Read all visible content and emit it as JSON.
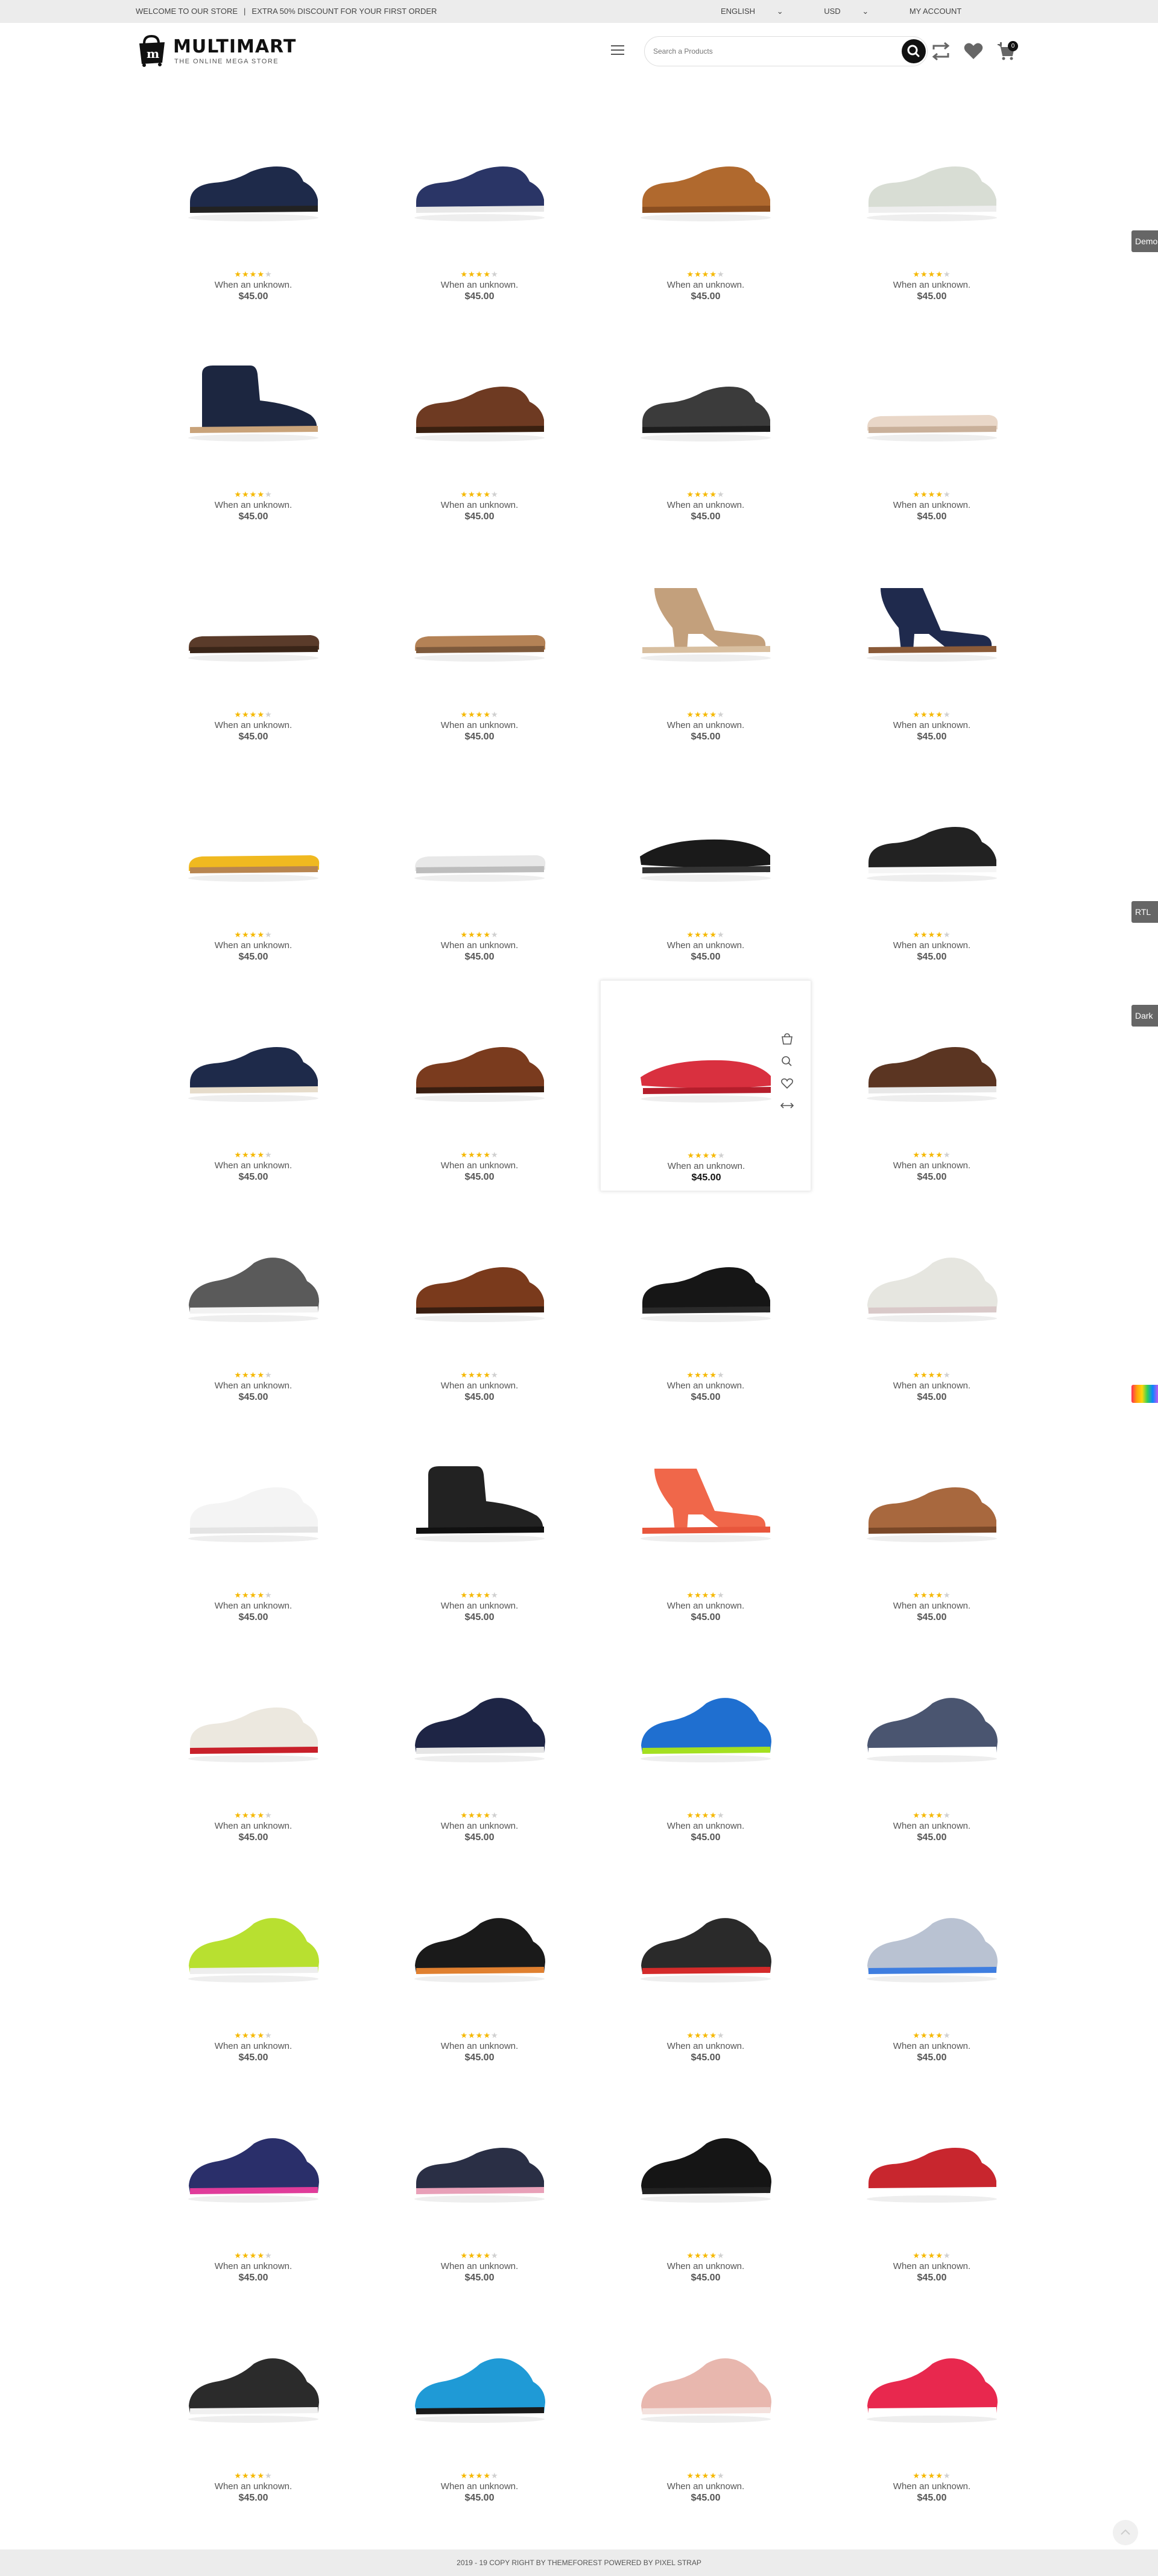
{
  "topbar": {
    "welcome": "WELCOME TO OUR STORE",
    "promo": "EXTRA 50% DISCOUNT FOR YOUR FIRST ORDER",
    "language": "ENGLISH",
    "currency": "USD",
    "account": "MY ACCOUNT"
  },
  "header": {
    "logo_title": "MULTIMART",
    "logo_tagline": "THE ONLINE MEGA STORE",
    "search_placeholder": "Search a Products",
    "cart_count": "0"
  },
  "rating_stars": 4,
  "products": [
    {
      "name": "When an unknown.",
      "price": "$45.00",
      "icon": "navy-suede-oxford"
    },
    {
      "name": "When an unknown.",
      "price": "$45.00",
      "icon": "navy-slip-on-sneaker"
    },
    {
      "name": "When an unknown.",
      "price": "$45.00",
      "icon": "tan-woven-loafer"
    },
    {
      "name": "When an unknown.",
      "price": "$45.00",
      "icon": "grey-canvas-sneaker"
    },
    {
      "name": "When an unknown.",
      "price": "$45.00",
      "icon": "navy-chukka-boot"
    },
    {
      "name": "When an unknown.",
      "price": "$45.00",
      "icon": "brown-brogue"
    },
    {
      "name": "When an unknown.",
      "price": "$45.00",
      "icon": "dark-grey-brogue"
    },
    {
      "name": "When an unknown.",
      "price": "$45.00",
      "icon": "lace-flat"
    },
    {
      "name": "When an unknown.",
      "price": "$45.00",
      "icon": "brown-flip-flop"
    },
    {
      "name": "When an unknown.",
      "price": "$45.00",
      "icon": "tan-flip-flop"
    },
    {
      "name": "When an unknown.",
      "price": "$45.00",
      "icon": "strappy-wedge-sandal"
    },
    {
      "name": "When an unknown.",
      "price": "$45.00",
      "icon": "navy-block-heel-bootie"
    },
    {
      "name": "When an unknown.",
      "price": "$45.00",
      "icon": "yellow-thong-sandal"
    },
    {
      "name": "When an unknown.",
      "price": "$45.00",
      "icon": "white-platform-sandal"
    },
    {
      "name": "When an unknown.",
      "price": "$45.00",
      "icon": "black-strap-slide"
    },
    {
      "name": "When an unknown.",
      "price": "$45.00",
      "icon": "checkered-skate-shoe"
    },
    {
      "name": "When an unknown.",
      "price": "$45.00",
      "icon": "navy-knit-oxford"
    },
    {
      "name": "When an unknown.",
      "price": "$45.00",
      "icon": "brown-cap-toe-oxford"
    },
    {
      "name": "When an unknown.",
      "price": "$45.00",
      "icon": "red-pool-slide"
    },
    {
      "name": "When an unknown.",
      "price": "$45.00",
      "icon": "brown-casual-oxford"
    },
    {
      "name": "When an unknown.",
      "price": "$45.00",
      "icon": "grey-running-shoe"
    },
    {
      "name": "When an unknown.",
      "price": "$45.00",
      "icon": "brown-derby"
    },
    {
      "name": "When an unknown.",
      "price": "$45.00",
      "icon": "black-loafer"
    },
    {
      "name": "When an unknown.",
      "price": "$45.00",
      "icon": "pastel-sneaker"
    },
    {
      "name": "When an unknown.",
      "price": "$45.00",
      "icon": "white-leather-sneaker"
    },
    {
      "name": "When an unknown.",
      "price": "$45.00",
      "icon": "black-combat-boot"
    },
    {
      "name": "When an unknown.",
      "price": "$45.00",
      "icon": "coral-block-heel-sandal"
    },
    {
      "name": "When an unknown.",
      "price": "$45.00",
      "icon": "tan-suede-loafer"
    },
    {
      "name": "When an unknown.",
      "price": "$45.00",
      "icon": "white-striped-sneaker"
    },
    {
      "name": "When an unknown.",
      "price": "$45.00",
      "icon": "navy-red-trainer"
    },
    {
      "name": "When an unknown.",
      "price": "$45.00",
      "icon": "blue-lime-running-shoe"
    },
    {
      "name": "When an unknown.",
      "price": "$45.00",
      "icon": "grey-swoosh-sneaker"
    },
    {
      "name": "When an unknown.",
      "price": "$45.00",
      "icon": "lime-running-shoe"
    },
    {
      "name": "When an unknown.",
      "price": "$45.00",
      "icon": "black-orange-trail-shoe"
    },
    {
      "name": "When an unknown.",
      "price": "$45.00",
      "icon": "black-red-trail-shoe"
    },
    {
      "name": "When an unknown.",
      "price": "$45.00",
      "icon": "silver-blue-runner"
    },
    {
      "name": "When an unknown.",
      "price": "$45.00",
      "icon": "navy-pink-runner"
    },
    {
      "name": "When an unknown.",
      "price": "$45.00",
      "icon": "polka-dot-sneaker"
    },
    {
      "name": "When an unknown.",
      "price": "$45.00",
      "icon": "black-knit-sneaker"
    },
    {
      "name": "When an unknown.",
      "price": "$45.00",
      "icon": "red-swoosh-sneaker"
    },
    {
      "name": "When an unknown.",
      "price": "$45.00",
      "icon": "black-zip-sneaker"
    },
    {
      "name": "When an unknown.",
      "price": "$45.00",
      "icon": "blue-black-runner"
    },
    {
      "name": "When an unknown.",
      "price": "$45.00",
      "icon": "pink-classic-sneaker"
    },
    {
      "name": "When an unknown.",
      "price": "$45.00",
      "icon": "red-running-shoe"
    }
  ],
  "side_tabs": {
    "demo": "Demo",
    "rtl": "RTL",
    "dark": "Dark"
  },
  "footer": {
    "copyright": "2019 - 19 COPY RIGHT BY THEMEFOREST POWERED BY PIXEL STRAP"
  }
}
